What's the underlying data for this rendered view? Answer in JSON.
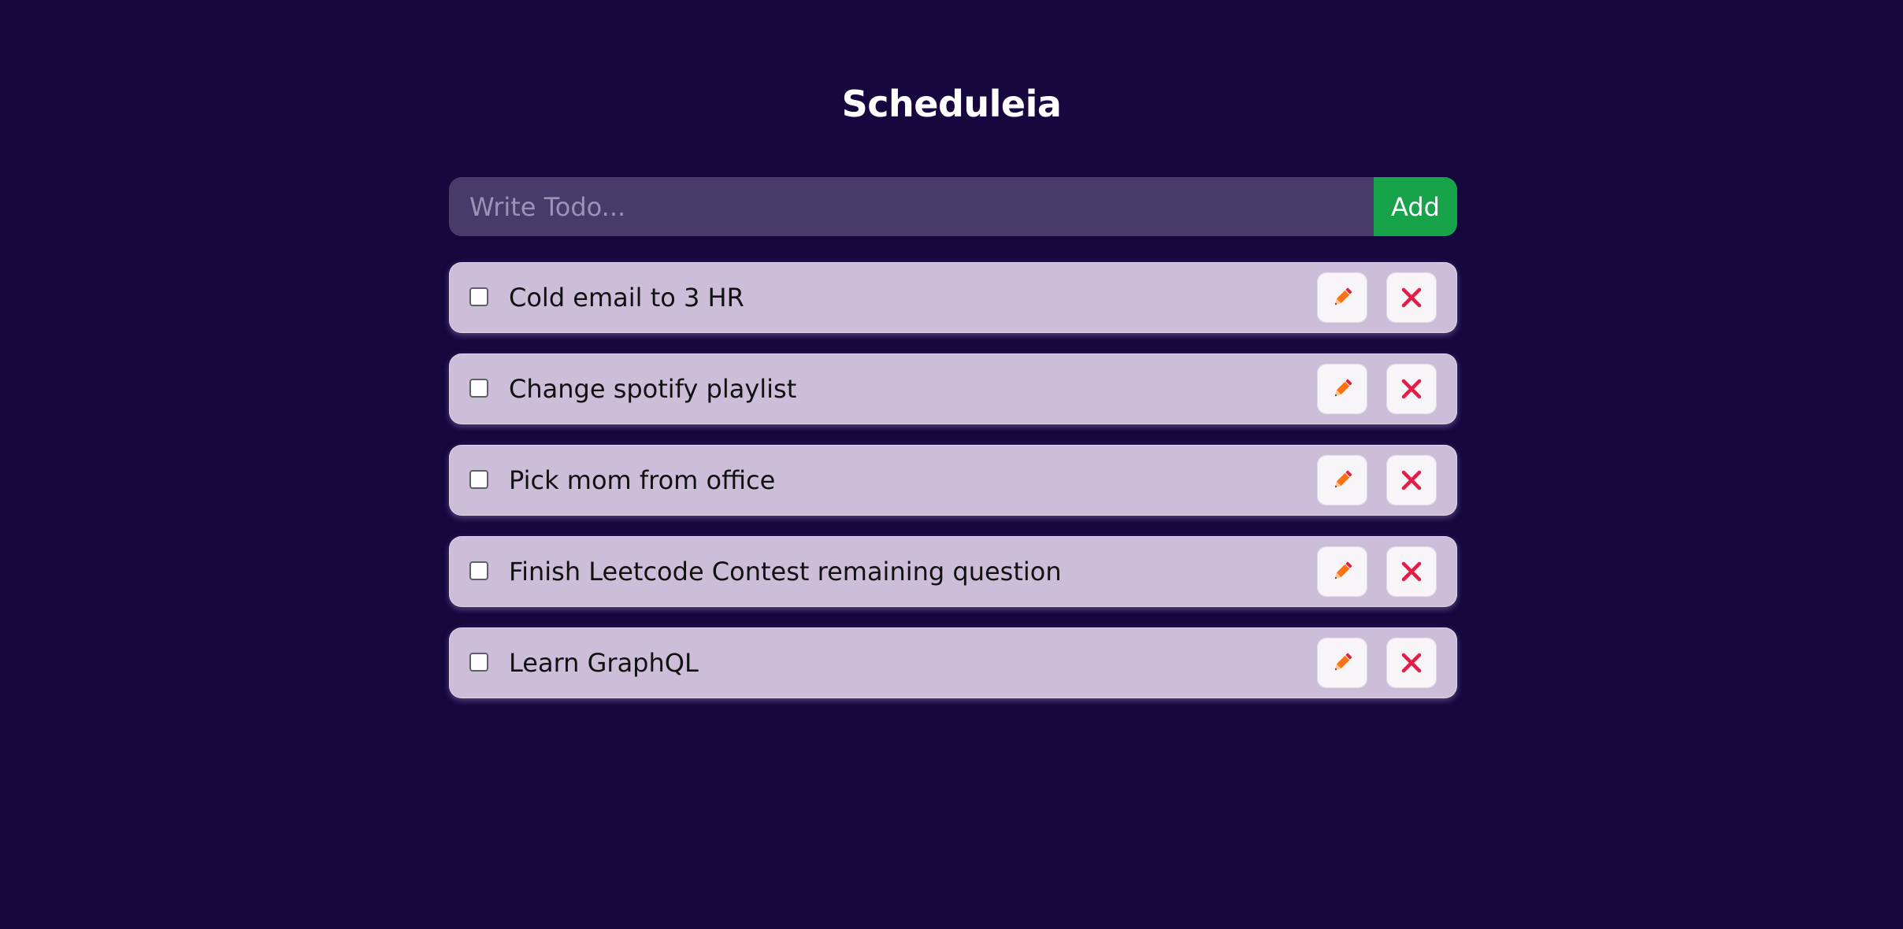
{
  "app": {
    "title": "Scheduleia"
  },
  "form": {
    "placeholder": "Write Todo...",
    "value": "",
    "add_label": "Add"
  },
  "todos": [
    {
      "text": "Cold email to 3 HR",
      "checked": false
    },
    {
      "text": "Change spotify playlist",
      "checked": false
    },
    {
      "text": "Pick mom from office",
      "checked": false
    },
    {
      "text": "Finish Leetcode Contest remaining question",
      "checked": false
    },
    {
      "text": "Learn GraphQL",
      "checked": false
    }
  ],
  "icons": {
    "edit": "pencil-icon",
    "delete": "close-icon"
  },
  "colors": {
    "background": "#16073f",
    "input_bg": "#463b69",
    "add_button": "#16a34a",
    "item_bg": "#ccbed8",
    "pencil": "#f97316",
    "delete": "#e11d48"
  }
}
